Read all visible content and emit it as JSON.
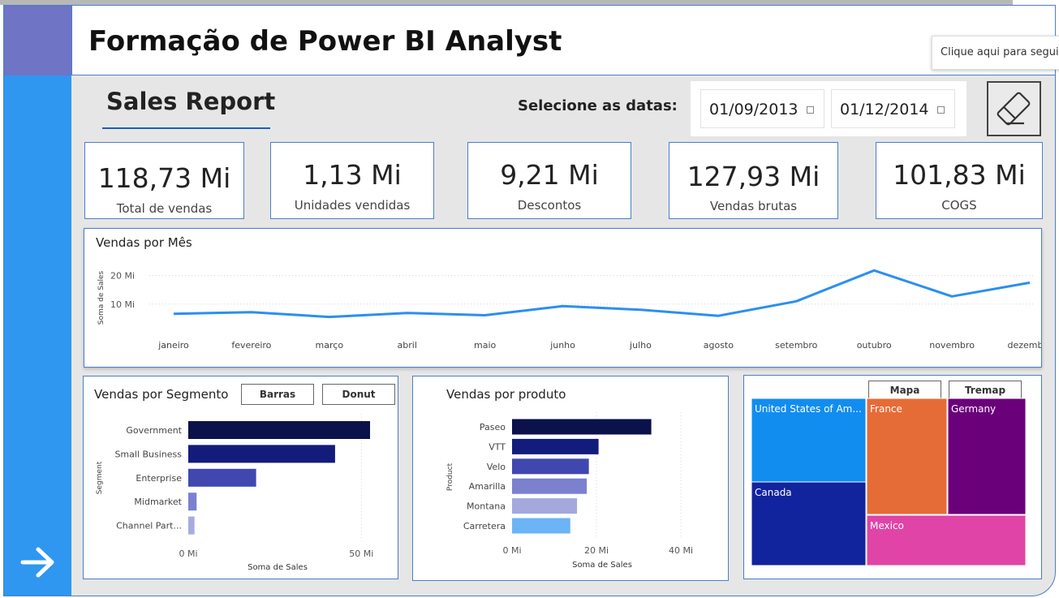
{
  "header": {
    "title": "Formação de Power BI Analyst"
  },
  "tooltip": {
    "text": "Clique aqui para seguir"
  },
  "report": {
    "title": "Sales Report",
    "date_label": "Selecione as datas:",
    "date_start": "01/09/2013",
    "date_end": "01/12/2014"
  },
  "kpis": [
    {
      "value": "118,73 Mi",
      "label": "Total de vendas"
    },
    {
      "value": "1,13 Mi",
      "label": "Unidades vendidas"
    },
    {
      "value": "9,21 Mi",
      "label": "Descontos"
    },
    {
      "value": "127,93 Mi",
      "label": "Vendas brutas"
    },
    {
      "value": "101,83 Mi",
      "label": "COGS"
    }
  ],
  "segment": {
    "btn_bars": "Barras",
    "btn_donut": "Donut"
  },
  "map": {
    "btn_map": "Mapa",
    "btn_treemap": "Tremap"
  },
  "colors": {
    "sidebar": "#2f97f0",
    "corner": "#6f74c4",
    "line": "#2b8ff0",
    "accent": "#1f5fb4"
  },
  "icons": {
    "arrow": "arrow-right-icon",
    "eraser": "eraser-icon",
    "calendar": "calendar-icon"
  },
  "chart_data": [
    {
      "type": "line",
      "title": "Vendas por Mês",
      "ylabel": "Soma de Sales",
      "ylim": [
        0,
        25
      ],
      "yticks": [
        "10 Mi",
        "20 Mi"
      ],
      "ytick_values": [
        10,
        20
      ],
      "grid": true,
      "categories": [
        "janeiro",
        "fevereiro",
        "março",
        "abril",
        "maio",
        "junho",
        "julho",
        "agosto",
        "setembro",
        "outubro",
        "novembro",
        "dezembro"
      ],
      "values": [
        6.6,
        7.2,
        5.5,
        6.9,
        6.1,
        9.3,
        8.0,
        5.9,
        11.0,
        21.8,
        12.7,
        17.5
      ]
    },
    {
      "type": "bar",
      "orientation": "horizontal",
      "title": "Vendas por Segmento",
      "xlabel": "Soma de Sales",
      "ylabel": "Segment",
      "xlim": [
        0,
        60
      ],
      "xticks": [
        "0 Mi",
        "50 Mi"
      ],
      "xtick_values": [
        0,
        50
      ],
      "categories": [
        "Government",
        "Small Business",
        "Enterprise",
        "Midmarket",
        "Channel Part..."
      ],
      "values": [
        52.5,
        42.4,
        19.6,
        2.4,
        1.8
      ],
      "colors": [
        "#0b114a",
        "#131c7a",
        "#4048b0",
        "#7b80cf",
        "#a8abdf"
      ]
    },
    {
      "type": "bar",
      "orientation": "horizontal",
      "title": "Vendas por produto",
      "xlabel": "Soma de Sales",
      "ylabel": "Product",
      "xlim": [
        0,
        45
      ],
      "xticks": [
        "0 Mi",
        "20 Mi",
        "40 Mi"
      ],
      "xtick_values": [
        0,
        20,
        40
      ],
      "categories": [
        "Paseo",
        "VTT",
        "Velo",
        "Amarilla",
        "Montana",
        "Carretera"
      ],
      "values": [
        33.0,
        20.5,
        18.2,
        17.7,
        15.4,
        13.8
      ],
      "colors": [
        "#0b114a",
        "#131c7a",
        "#4048b0",
        "#7b80cf",
        "#a4a8dd",
        "#6cb4f5"
      ]
    },
    {
      "type": "treemap",
      "categories": [
        "United States of Am...",
        "Canada",
        "France",
        "Germany",
        "Mexico"
      ],
      "values": [
        25.0,
        24.9,
        24.4,
        23.5,
        20.9
      ],
      "colors": [
        "#118df0",
        "#12239e",
        "#e66c37",
        "#6b007b",
        "#e044a7"
      ]
    }
  ]
}
